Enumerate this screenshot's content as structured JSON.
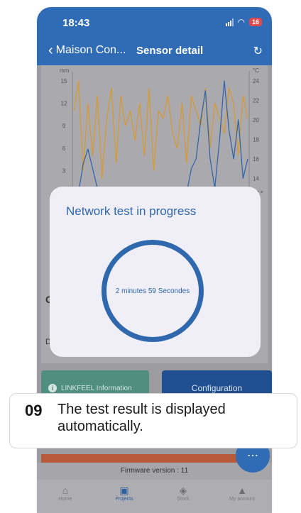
{
  "status_bar": {
    "time": "18:43",
    "battery": "16"
  },
  "nav": {
    "back_label": "Maison Con...",
    "title": "Sensor detail"
  },
  "chart": {
    "left_unit": "mm",
    "right_unit": "°C",
    "left_ticks": [
      "15",
      "12",
      "9",
      "6",
      "3"
    ],
    "right_ticks": [
      "24",
      "22",
      "20",
      "18",
      "16",
      "14",
      "12.5"
    ]
  },
  "chart_data": {
    "type": "line",
    "title": "",
    "xlabel": "",
    "ylabel": "mm",
    "ylabel_right": "°C",
    "ylim": [
      0,
      15
    ],
    "ylim_right": [
      12.5,
      24
    ],
    "series": [
      {
        "axis": "left",
        "color": "#d99a2b",
        "values": [
          11,
          15,
          3,
          12,
          5,
          13,
          2,
          10,
          14,
          4,
          13,
          9,
          11,
          7,
          12,
          5,
          14,
          3,
          11,
          10,
          13,
          8,
          6,
          12,
          4,
          13,
          11,
          9,
          14,
          6,
          12,
          10,
          8,
          14,
          12,
          5,
          13,
          10
        ]
      },
      {
        "axis": "right",
        "color": "#2a62ad",
        "values": [
          12.5,
          12.5,
          15.5,
          17,
          15,
          13,
          12.5,
          12.5,
          12.5,
          12.5,
          12.5,
          12.5,
          12.5,
          12.5,
          12.5,
          12.5,
          12.5,
          12.5,
          12.5,
          12.5,
          12.5,
          12.5,
          12.5,
          12.5,
          12.5,
          15,
          16,
          20,
          23,
          16,
          13,
          18,
          24,
          19,
          16,
          20,
          14,
          16
        ]
      }
    ]
  },
  "background": {
    "peek_left_1": "C",
    "peek_left_2": "D"
  },
  "modal": {
    "title": "Network test in progress",
    "timer": "2 minutes 59 Secondes"
  },
  "buttons": {
    "info": "LINKFEEL Information",
    "config": "Configuration"
  },
  "firmware": "Firmware version : 11",
  "tabs": [
    {
      "label": "Home",
      "icon": "home-icon"
    },
    {
      "label": "Projects",
      "icon": "briefcase-icon"
    },
    {
      "label": "Stock",
      "icon": "box-icon"
    },
    {
      "label": "My account",
      "icon": "person-icon"
    }
  ],
  "callout": {
    "number": "09",
    "text": "The test result is displayed automatically."
  },
  "colors": {
    "primary": "#2f6cb5",
    "modal_accent": "#2f68ad",
    "info_button": "#4f8e80",
    "config_button": "#1f4f8e"
  }
}
